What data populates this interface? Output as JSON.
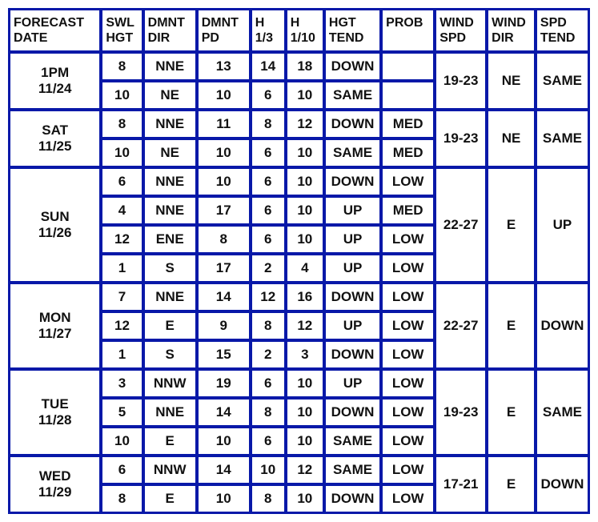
{
  "headers": {
    "date": "FORECAST\nDATE",
    "swl": "SWL\nHGT",
    "ddir": "DMNT\nDIR",
    "dpd": "DMNT\nPD",
    "h13": "H\n1/3",
    "h110": "H\n1/10",
    "htend": "HGT\nTEND",
    "prob": "PROB",
    "wspd": "WIND\nSPD",
    "wdir": "WIND\nDIR",
    "stend": "SPD\nTEND"
  },
  "days": [
    {
      "label": "1PM\n11/24",
      "wind_spd": "19-23",
      "wind_dir": "NE",
      "spd_tend": "SAME",
      "swells": [
        {
          "hgt": "8",
          "dir": "NNE",
          "pd": "13",
          "h13": "14",
          "h110": "18",
          "tend": "DOWN",
          "prob": ""
        },
        {
          "hgt": "10",
          "dir": "NE",
          "pd": "10",
          "h13": "6",
          "h110": "10",
          "tend": "SAME",
          "prob": ""
        }
      ]
    },
    {
      "label": "SAT\n11/25",
      "wind_spd": "19-23",
      "wind_dir": "NE",
      "spd_tend": "SAME",
      "swells": [
        {
          "hgt": "8",
          "dir": "NNE",
          "pd": "11",
          "h13": "8",
          "h110": "12",
          "tend": "DOWN",
          "prob": "MED"
        },
        {
          "hgt": "10",
          "dir": "NE",
          "pd": "10",
          "h13": "6",
          "h110": "10",
          "tend": "SAME",
          "prob": "MED"
        }
      ]
    },
    {
      "label": "SUN\n11/26",
      "wind_spd": "22-27",
      "wind_dir": "E",
      "spd_tend": "UP",
      "swells": [
        {
          "hgt": "6",
          "dir": "NNE",
          "pd": "10",
          "h13": "6",
          "h110": "10",
          "tend": "DOWN",
          "prob": "LOW"
        },
        {
          "hgt": "4",
          "dir": "NNE",
          "pd": "17",
          "h13": "6",
          "h110": "10",
          "tend": "UP",
          "prob": "MED"
        },
        {
          "hgt": "12",
          "dir": "ENE",
          "pd": "8",
          "h13": "6",
          "h110": "10",
          "tend": "UP",
          "prob": "LOW"
        },
        {
          "hgt": "1",
          "dir": "S",
          "pd": "17",
          "h13": "2",
          "h110": "4",
          "tend": "UP",
          "prob": "LOW"
        }
      ]
    },
    {
      "label": "MON\n11/27",
      "wind_spd": "22-27",
      "wind_dir": "E",
      "spd_tend": "DOWN",
      "swells": [
        {
          "hgt": "7",
          "dir": "NNE",
          "pd": "14",
          "h13": "12",
          "h110": "16",
          "tend": "DOWN",
          "prob": "LOW"
        },
        {
          "hgt": "12",
          "dir": "E",
          "pd": "9",
          "h13": "8",
          "h110": "12",
          "tend": "UP",
          "prob": "LOW"
        },
        {
          "hgt": "1",
          "dir": "S",
          "pd": "15",
          "h13": "2",
          "h110": "3",
          "tend": "DOWN",
          "prob": "LOW"
        }
      ]
    },
    {
      "label": "TUE\n11/28",
      "wind_spd": "19-23",
      "wind_dir": "E",
      "spd_tend": "SAME",
      "swells": [
        {
          "hgt": "3",
          "dir": "NNW",
          "pd": "19",
          "h13": "6",
          "h110": "10",
          "tend": "UP",
          "prob": "LOW"
        },
        {
          "hgt": "5",
          "dir": "NNE",
          "pd": "14",
          "h13": "8",
          "h110": "10",
          "tend": "DOWN",
          "prob": "LOW"
        },
        {
          "hgt": "10",
          "dir": "E",
          "pd": "10",
          "h13": "6",
          "h110": "10",
          "tend": "SAME",
          "prob": "LOW"
        }
      ]
    },
    {
      "label": "WED\n11/29",
      "wind_spd": "17-21",
      "wind_dir": "E",
      "spd_tend": "DOWN",
      "swells": [
        {
          "hgt": "6",
          "dir": "NNW",
          "pd": "14",
          "h13": "10",
          "h110": "12",
          "tend": "SAME",
          "prob": "LOW"
        },
        {
          "hgt": "8",
          "dir": "E",
          "pd": "10",
          "h13": "8",
          "h110": "10",
          "tend": "DOWN",
          "prob": "LOW"
        }
      ]
    }
  ]
}
